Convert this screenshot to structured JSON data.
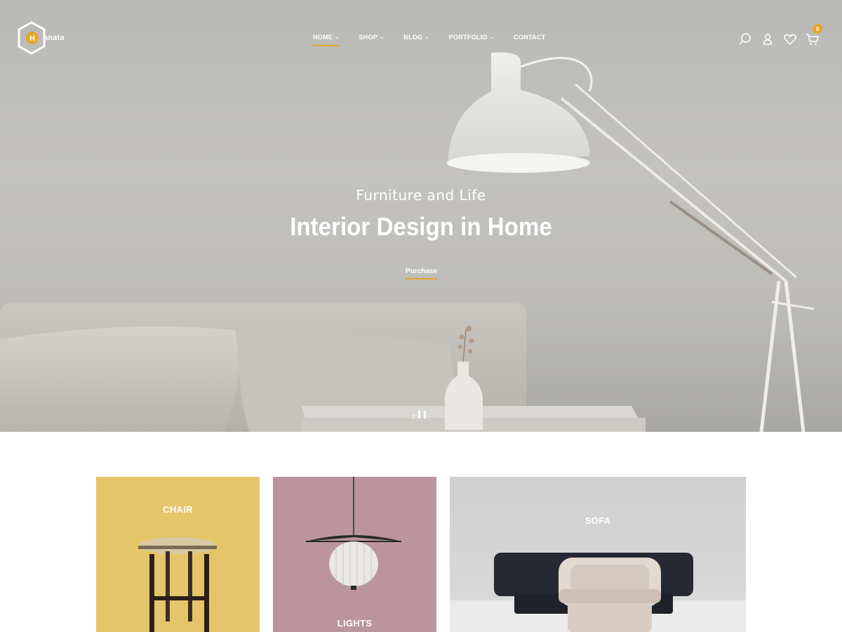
{
  "brand": {
    "logo_letter": "H",
    "name": "anata",
    "accent_color": "#e4a72d"
  },
  "nav": {
    "items": [
      {
        "label": "HOME",
        "has_dropdown": true,
        "active": true
      },
      {
        "label": "SHOP",
        "has_dropdown": true,
        "active": false
      },
      {
        "label": "BLOG",
        "has_dropdown": true,
        "active": false
      },
      {
        "label": "PORTFOLIO",
        "has_dropdown": true,
        "active": false
      },
      {
        "label": "CONTACT",
        "has_dropdown": false,
        "active": false
      }
    ],
    "chevron": "⌄"
  },
  "header_icons": {
    "search": "search-icon",
    "account": "user-icon",
    "wishlist": "heart-icon",
    "cart": "cart-icon",
    "cart_count": "0"
  },
  "hero": {
    "subtitle": "Furniture and Life",
    "title": "Interior Design in Home",
    "button_label": "Purchase",
    "slides_total": 3,
    "active_slide": 1
  },
  "categories": [
    {
      "label": "CHAIR",
      "color": "#e4c56a"
    },
    {
      "label": "LIGHTS",
      "color": "#bb959e"
    },
    {
      "label": "SOFA",
      "color": "#d4d4d4"
    }
  ]
}
